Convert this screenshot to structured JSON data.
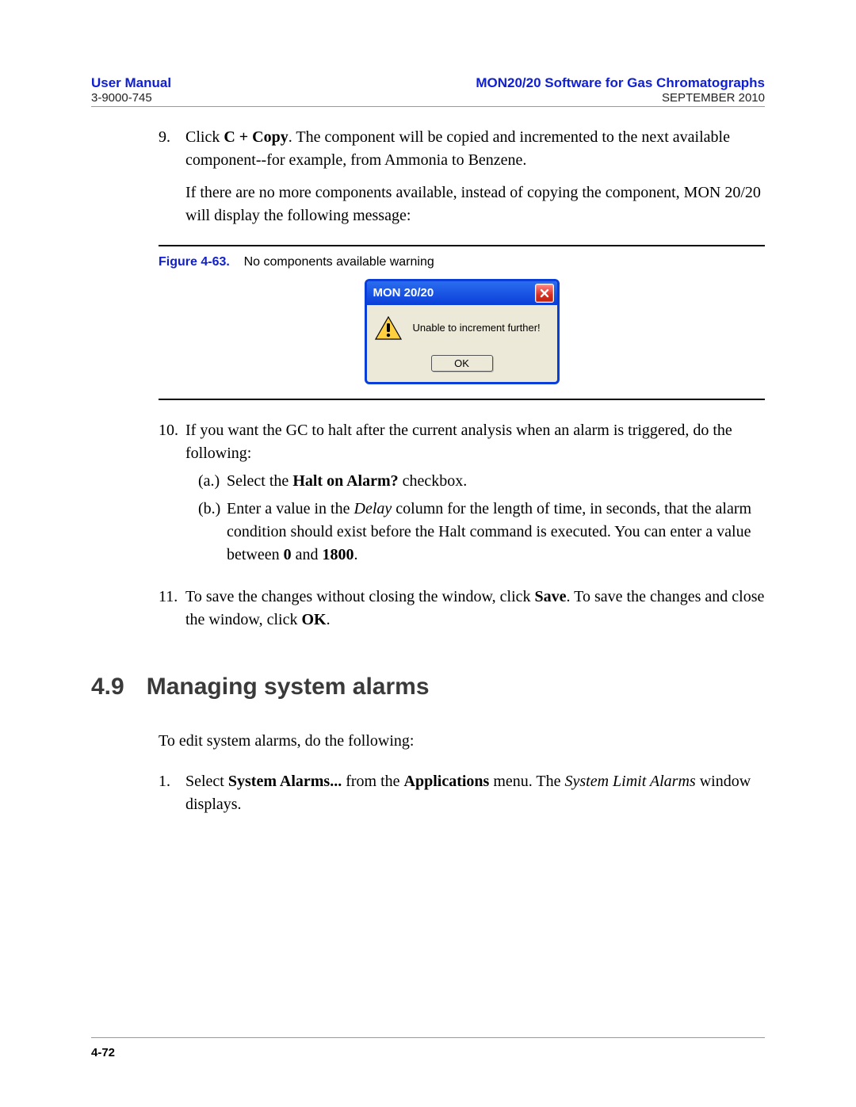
{
  "header": {
    "left_title": "User Manual",
    "left_sub": "3-9000-745",
    "right_title": "MON20/20 Software for Gas Chromatographs",
    "right_sub": "SEPTEMBER 2010"
  },
  "step9": {
    "num": "9.",
    "line1_a": "Click ",
    "line1_bold": "C + Copy",
    "line1_b": ". The component will be copied and incremented to the next available component--for example, from Ammonia to Benzene.",
    "para2": "If there are no more components available, instead of copying the component, MON 20/20 will display the following message:"
  },
  "figure": {
    "label": "Figure 4-63.",
    "caption": "No components available warning",
    "dialog": {
      "title": "MON 20/20",
      "message": "Unable to increment further!",
      "ok": "OK"
    }
  },
  "step10": {
    "num": "10.",
    "intro": "If you want the GC to halt after the current analysis when an alarm is triggered, do the following:",
    "a_lbl": "(a.)",
    "a_pre": "Select the ",
    "a_bold": "Halt on Alarm?",
    "a_post": " checkbox.",
    "b_lbl": "(b.)",
    "b_pre": "Enter a value in the ",
    "b_italic": "Delay",
    "b_mid": " column for the length of time, in seconds, that the alarm condition should exist before the Halt command is executed.  You can enter a value between ",
    "b_bold1": "0",
    "b_and": " and ",
    "b_bold2": "1800",
    "b_end": "."
  },
  "step11": {
    "num": "11.",
    "pre": "To save the changes without closing the window, click ",
    "bold1": "Save",
    "mid": ". To save the changes and close the window, click ",
    "bold2": "OK",
    "end": "."
  },
  "heading": {
    "num": "4.9",
    "text": "Managing system alarms"
  },
  "section_intro": "To edit system alarms, do the following:",
  "section_step1": {
    "num": "1.",
    "pre": "Select ",
    "bold1": "System Alarms...",
    "mid1": " from the ",
    "bold2": "Applications",
    "mid2": " menu.  The ",
    "italic": "System Limit Alarms",
    "end": " window displays."
  },
  "footer": {
    "page": "4-72"
  }
}
